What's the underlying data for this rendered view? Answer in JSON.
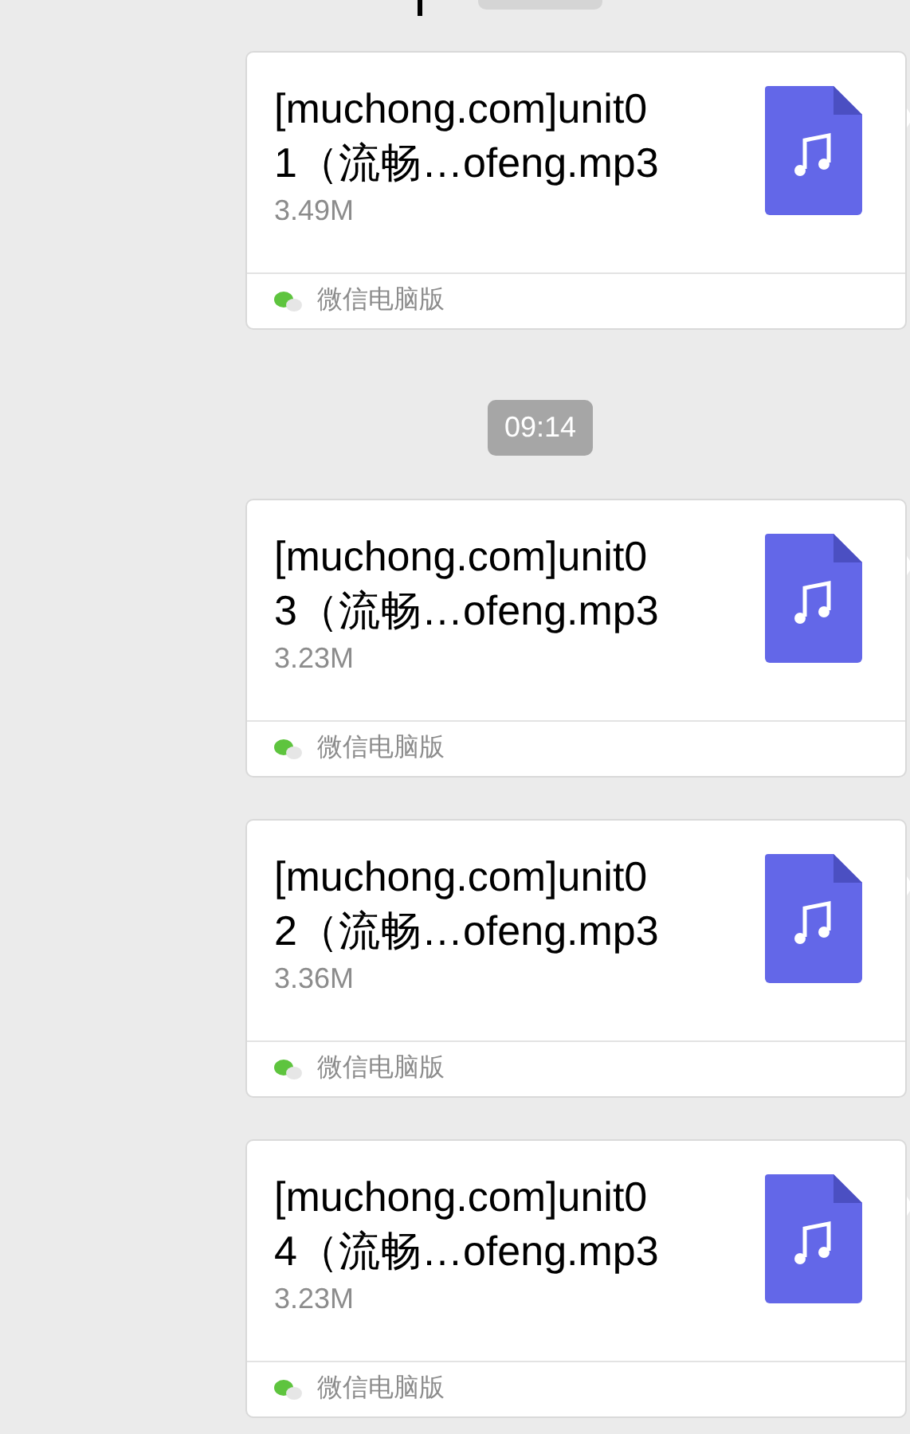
{
  "messages": [
    {
      "kind": "file",
      "title_line1": "[muchong.com]unit0",
      "title_line2": "1（流畅…ofeng.mp3",
      "size": "3.49M",
      "source": "微信电脑版"
    },
    {
      "kind": "time",
      "text": "09:14"
    },
    {
      "kind": "file",
      "title_line1": "[muchong.com]unit0",
      "title_line2": "3（流畅…ofeng.mp3",
      "size": "3.23M",
      "source": "微信电脑版"
    },
    {
      "kind": "file",
      "title_line1": "[muchong.com]unit0",
      "title_line2": "2（流畅…ofeng.mp3",
      "size": "3.36M",
      "source": "微信电脑版"
    },
    {
      "kind": "file",
      "title_line1": "[muchong.com]unit0",
      "title_line2": "4（流畅…ofeng.mp3",
      "size": "3.23M",
      "source": "微信电脑版"
    }
  ]
}
